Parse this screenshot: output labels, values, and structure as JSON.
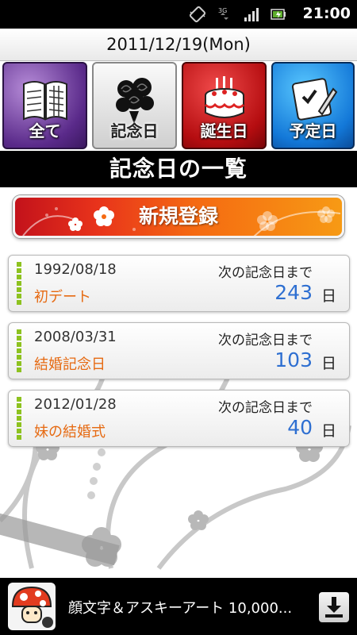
{
  "status_bar": {
    "time": "21:00",
    "network": "3G",
    "icons": [
      "vibrate-icon",
      "data-activity-icon",
      "signal-icon",
      "battery-charging-icon"
    ]
  },
  "header": {
    "date": "2011/12/19(Mon)"
  },
  "tabs": [
    {
      "label": "全て",
      "icon": "calendar-book-icon"
    },
    {
      "label": "記念日",
      "icon": "roses-icon"
    },
    {
      "label": "誕生日",
      "icon": "birthday-cake-icon"
    },
    {
      "label": "予定日",
      "icon": "checklist-pen-icon"
    }
  ],
  "title": "記念日の一覧",
  "register_button": {
    "label": "新規登録"
  },
  "anniversaries": [
    {
      "date": "1992/08/18",
      "name": "初デート",
      "until_label": "次の記念日まで",
      "days": "243",
      "unit": "日"
    },
    {
      "date": "2008/03/31",
      "name": "結婚記念日",
      "until_label": "次の記念日まで",
      "days": "103",
      "unit": "日"
    },
    {
      "date": "2012/01/28",
      "name": "妹の結婚式",
      "until_label": "次の記念日まで",
      "days": "40",
      "unit": "日"
    }
  ],
  "ad": {
    "text": "顔文字＆アスキーアート 10,000...",
    "icon": "mushroom-app-icon",
    "download_icon": "download-icon"
  },
  "colors": {
    "accent_orange": "#e66a12",
    "days_blue": "#2e6fd1",
    "marker_green": "#8dc21f",
    "tab_all": "#5a2a8a",
    "tab_birthday": "#b50d10",
    "tab_schedule": "#1378d8"
  }
}
